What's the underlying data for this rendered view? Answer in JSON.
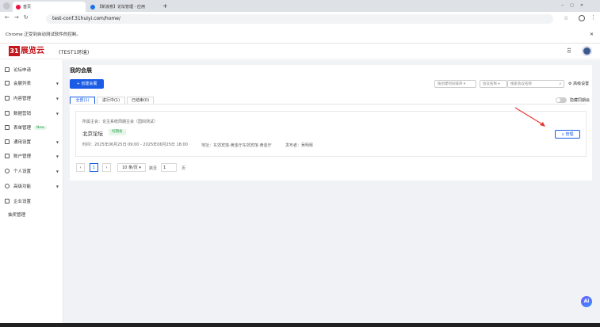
{
  "browser": {
    "tabs": [
      {
        "label": "首页"
      },
      {
        "label": "【新浪意】论坛管理 - 应用"
      }
    ],
    "new_tab": "+",
    "url": "test-conf.31huiyi.com/home/",
    "infobar": "Chrome 正受到自动测试软件的控制。",
    "infobar_close": "✕"
  },
  "app": {
    "logo_mark": "31",
    "logo_text": "展览云",
    "env": "(TEST1环境)"
  },
  "sidebar": {
    "items": [
      {
        "label": "论坛申请",
        "caret": ""
      },
      {
        "label": "会展列表",
        "caret": "▼"
      },
      {
        "label": "内容管理",
        "caret": "▼"
      },
      {
        "label": "数据营销",
        "caret": "▼"
      },
      {
        "label": "表单管理",
        "badge": "New",
        "caret": ""
      },
      {
        "label": "通用设置",
        "caret": "▼"
      },
      {
        "label": "账户管理",
        "caret": "▼"
      },
      {
        "label": "个人设置",
        "caret": "▼"
      },
      {
        "label": "高级功能",
        "caret": "▼"
      },
      {
        "label": "企业设置",
        "caret": ""
      },
      {
        "label": "抽奖管理",
        "caret": ""
      }
    ]
  },
  "main": {
    "title": "我的会展",
    "create_button": "+ 创建会展",
    "filter_time": "按创建时间排序 ▾",
    "filter_name": "会议名称 ▾",
    "search_placeholder": "搜索会议名称",
    "advanced": "高级设置",
    "tabs": [
      {
        "label": "全部(1)"
      },
      {
        "label": "进行中(1)"
      },
      {
        "label": "已结束(0)"
      }
    ],
    "hide_toggle_label": "隐藏同期会",
    "event": {
      "owner": "所属主会：论主系统周期主会（国四测试）",
      "name": "北京论坛",
      "tag": "同期会",
      "time": "时间：2025年06月25日 09:00 - 2025年06月25日 18:00",
      "address": "地址：东郊宾馆-黄金厅东郊宾馆-黄金厅",
      "publisher": "发布者：吴明辉",
      "manage_button": "管理"
    },
    "pagination": {
      "prev": "‹",
      "current": "1",
      "next": "›",
      "page_size": "10 条/页 ▾",
      "goto_label": "跳至",
      "goto_value": "1",
      "page_unit": "页"
    }
  },
  "ai_badge": "Ai"
}
